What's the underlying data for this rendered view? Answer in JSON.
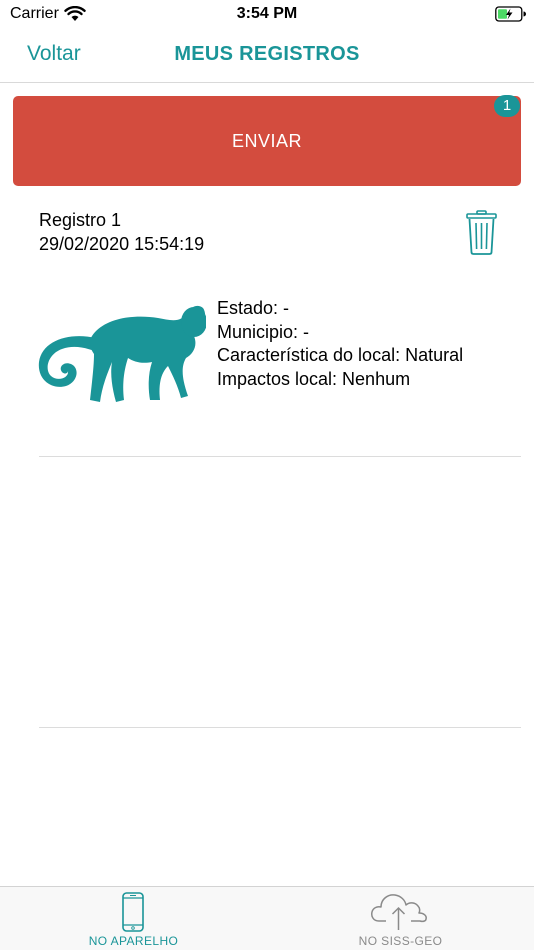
{
  "status_bar": {
    "carrier": "Carrier",
    "time": "3:54 PM"
  },
  "nav": {
    "back_label": "Voltar",
    "title": "MEUS REGISTROS"
  },
  "send": {
    "label": "ENVIAR",
    "badge_count": "1"
  },
  "record": {
    "name": "Registro 1",
    "datetime": "29/02/2020 15:54:19",
    "details": {
      "estado": "Estado: -",
      "municipio": "Municipio: -",
      "caracteristica": "Característica do local: Natural",
      "impactos": "Impactos local: Nenhum"
    }
  },
  "tabs": [
    {
      "label": "NO APARELHO",
      "icon": "phone-icon",
      "selected": true
    },
    {
      "label": "NO SISS-GEO",
      "icon": "cloud-upload-icon",
      "selected": false
    }
  ],
  "colors": {
    "accent": "#1a9598",
    "send_button": "#d34c3e",
    "inactive_tab": "#8a8a8a"
  }
}
